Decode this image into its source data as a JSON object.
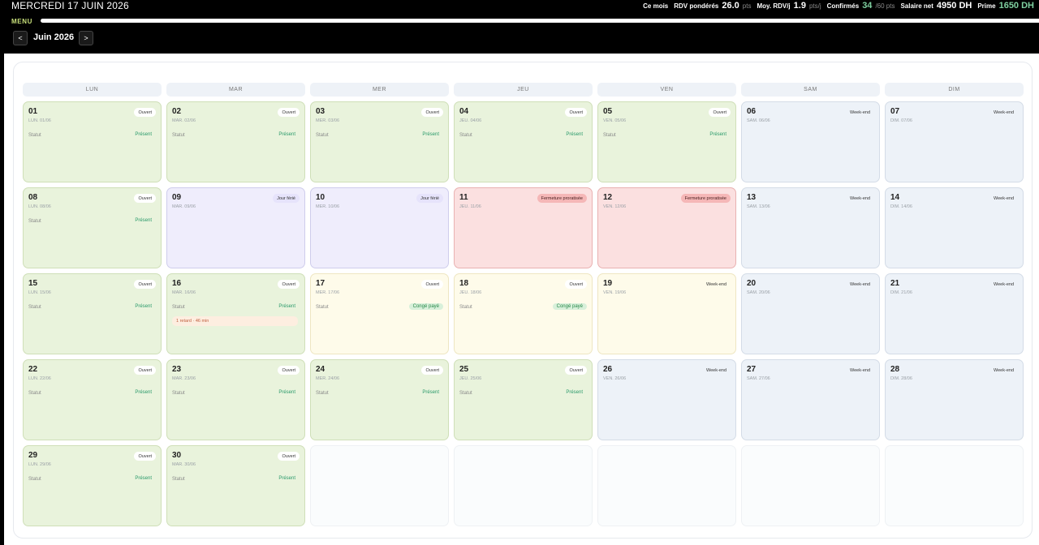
{
  "header": {
    "date_title": "MERCREDI 17 JUIN 2026",
    "menu_label": "MENU",
    "stats": {
      "ce_mois_label": "Ce mois",
      "rdv_label": "RDV pondérés",
      "rdv_value": "26.0",
      "rdv_unit": "pts",
      "moy_label": "Moy. RDV/j",
      "moy_value": "1.9",
      "moy_unit": "pts/j",
      "confirmes_label": "Confirmés",
      "confirmes_value": "34",
      "confirmes_unit": "/60 pts",
      "salaire_label": "Salaire net",
      "salaire_value": "4950 DH",
      "prime_label": "Prime",
      "prime_value": "1650 DH"
    }
  },
  "nav": {
    "prev": "<",
    "next": ">",
    "month": "Juin 2026"
  },
  "weekdays": [
    "LUN",
    "MAR",
    "MER",
    "JEU",
    "VEN",
    "SAM",
    "DIM"
  ],
  "status_label": "Statut",
  "days": [
    {
      "num": "01",
      "sub": "LUN. 01/06",
      "badge": "Ouvert",
      "type": "open",
      "status": "Présent"
    },
    {
      "num": "02",
      "sub": "MAR. 02/06",
      "badge": "Ouvert",
      "type": "open",
      "status": "Présent"
    },
    {
      "num": "03",
      "sub": "MER. 03/06",
      "badge": "Ouvert",
      "type": "open",
      "status": "Présent"
    },
    {
      "num": "04",
      "sub": "JEU. 04/06",
      "badge": "Ouvert",
      "type": "open",
      "status": "Présent"
    },
    {
      "num": "05",
      "sub": "VEN. 05/06",
      "badge": "Ouvert",
      "type": "open",
      "status": "Présent"
    },
    {
      "num": "06",
      "sub": "SAM. 06/06",
      "badge": "Week-end",
      "type": "weekend"
    },
    {
      "num": "07",
      "sub": "DIM. 07/06",
      "badge": "Week-end",
      "type": "weekend"
    },
    {
      "num": "08",
      "sub": "LUN. 08/06",
      "badge": "Ouvert",
      "type": "open",
      "status": "Présent"
    },
    {
      "num": "09",
      "sub": "MAR. 09/06",
      "badge": "Jour férié",
      "type": "holiday"
    },
    {
      "num": "10",
      "sub": "MER. 10/06",
      "badge": "Jour férié",
      "type": "holiday"
    },
    {
      "num": "11",
      "sub": "JEU. 11/06",
      "badge": "Fermeture proratisée",
      "type": "closed"
    },
    {
      "num": "12",
      "sub": "VEN. 12/06",
      "badge": "Fermeture proratisée",
      "type": "closed"
    },
    {
      "num": "13",
      "sub": "SAM. 13/06",
      "badge": "Week-end",
      "type": "weekend"
    },
    {
      "num": "14",
      "sub": "DIM. 14/06",
      "badge": "Week-end",
      "type": "weekend"
    },
    {
      "num": "15",
      "sub": "LUN. 15/06",
      "badge": "Ouvert",
      "type": "open",
      "status": "Présent"
    },
    {
      "num": "16",
      "sub": "MAR. 16/06",
      "badge": "Ouvert",
      "type": "open",
      "status": "Présent",
      "late": "1 retard · 46 min"
    },
    {
      "num": "17",
      "sub": "MER. 17/06",
      "badge": "Ouvert",
      "type": "leave",
      "status": "Congé payé"
    },
    {
      "num": "18",
      "sub": "JEU. 18/06",
      "badge": "Ouvert",
      "type": "leave",
      "status": "Congé payé"
    },
    {
      "num": "19",
      "sub": "VEN. 19/06",
      "badge": "Week-end",
      "type": "leave"
    },
    {
      "num": "20",
      "sub": "SAM. 20/06",
      "badge": "Week-end",
      "type": "weekend"
    },
    {
      "num": "21",
      "sub": "DIM. 21/06",
      "badge": "Week-end",
      "type": "weekend"
    },
    {
      "num": "22",
      "sub": "LUN. 22/06",
      "badge": "Ouvert",
      "type": "open",
      "status": "Présent"
    },
    {
      "num": "23",
      "sub": "MAR. 23/06",
      "badge": "Ouvert",
      "type": "open",
      "status": "Présent"
    },
    {
      "num": "24",
      "sub": "MER. 24/06",
      "badge": "Ouvert",
      "type": "open",
      "status": "Présent"
    },
    {
      "num": "25",
      "sub": "JEU. 25/06",
      "badge": "Ouvert",
      "type": "open",
      "status": "Présent"
    },
    {
      "num": "26",
      "sub": "VEN. 26/06",
      "badge": "Week-end",
      "type": "weekend"
    },
    {
      "num": "27",
      "sub": "SAM. 27/06",
      "badge": "Week-end",
      "type": "weekend"
    },
    {
      "num": "28",
      "sub": "DIM. 28/06",
      "badge": "Week-end",
      "type": "weekend"
    },
    {
      "num": "29",
      "sub": "LUN. 29/06",
      "badge": "Ouvert",
      "type": "open",
      "status": "Présent"
    },
    {
      "num": "30",
      "sub": "MAR. 30/06",
      "badge": "Ouvert",
      "type": "open",
      "status": "Présent"
    }
  ]
}
